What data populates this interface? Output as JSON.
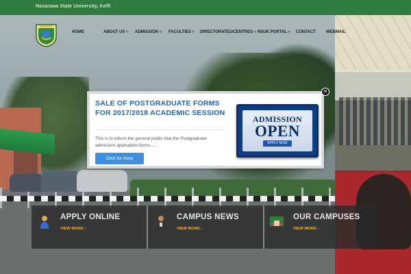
{
  "topbar": {
    "university": "Nasarawa State University, Keffi"
  },
  "nav": {
    "items": [
      {
        "label": "HOME",
        "dropdown": false
      },
      {
        "label": "ABOUT US",
        "dropdown": true
      },
      {
        "label": "ADMISSION",
        "dropdown": true
      },
      {
        "label": "FACULTIES",
        "dropdown": true
      },
      {
        "label": "DIRECTORATES/CENTRES",
        "dropdown": true
      },
      {
        "label": "NSUK PORTAL",
        "dropdown": true
      },
      {
        "label": "CONTACT",
        "dropdown": false
      },
      {
        "label": "WEBMAIL",
        "dropdown": false
      }
    ],
    "chevron": "˅"
  },
  "modal": {
    "title": "SALE OF POSTGRADUATE FORMS FOR 2017/2018 ACADEMIC SESSION",
    "body": "This is to inform the general public that the Postgraduate admission application forms......",
    "button": "Click for more",
    "close": "✕",
    "image": {
      "line1": "ADMISSION",
      "line2": "OPEN",
      "apply": "APPLY NOW"
    }
  },
  "panels": [
    {
      "title": "APPLY ONLINE",
      "link": "VIEW MORE ›",
      "icon": "person-icon"
    },
    {
      "title": "CAMPUS NEWS",
      "link": "VIEW MORE ›",
      "icon": "reporter-icon"
    },
    {
      "title": "OUR CAMPUSES",
      "link": "VIEW MORE ›",
      "icon": "campus-icon"
    }
  ],
  "colors": {
    "topbar": "#2e7d3e",
    "modal_title": "#1e63b4",
    "button": "#3d8fe0",
    "panel_link": "#f5b52e"
  }
}
